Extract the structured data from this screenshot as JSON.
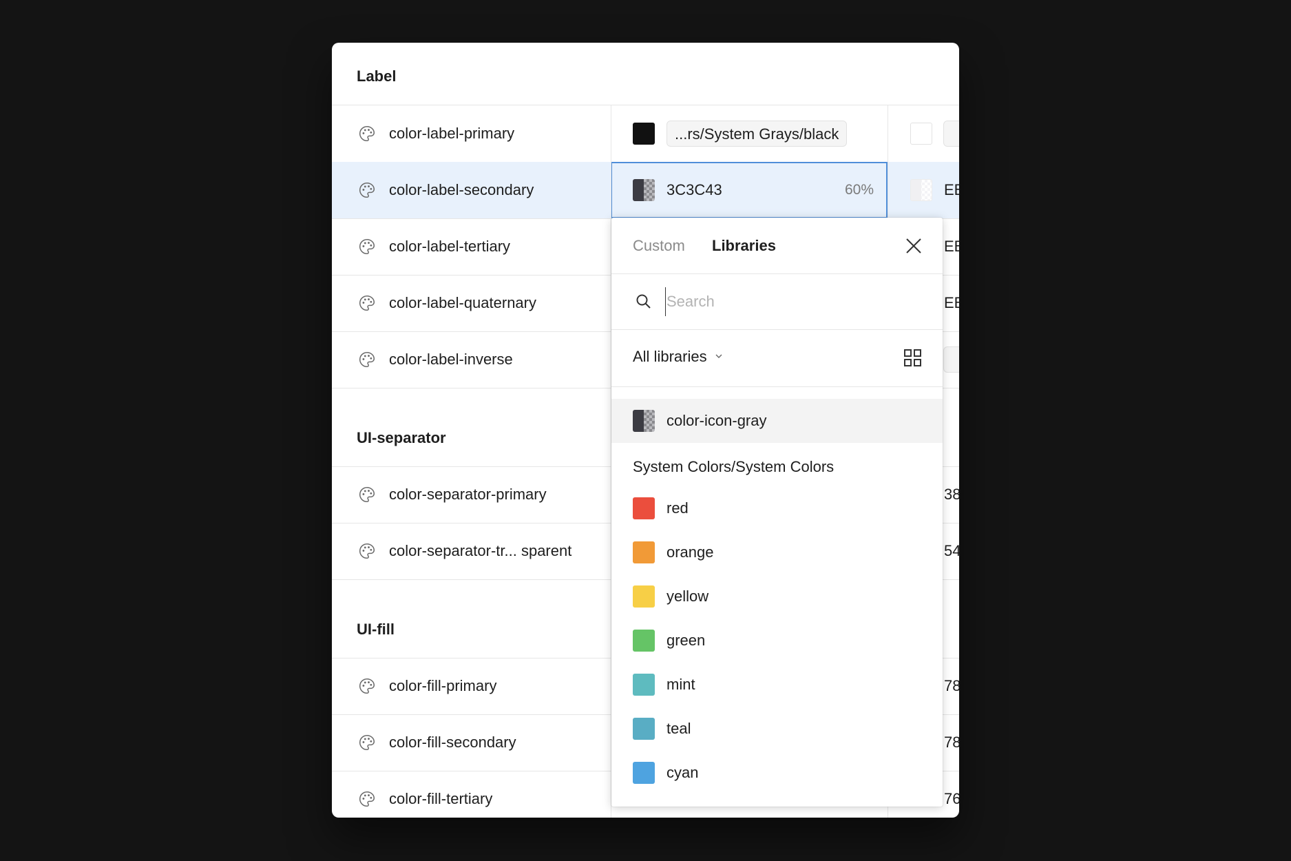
{
  "groups": [
    {
      "title": "Label"
    },
    {
      "title": "UI-separator"
    },
    {
      "title": "UI-fill"
    }
  ],
  "rows": {
    "label": [
      {
        "name": "color-label-primary"
      },
      {
        "name": "color-label-secondary"
      },
      {
        "name": "color-label-tertiary"
      },
      {
        "name": "color-label-quaternary"
      },
      {
        "name": "color-label-inverse"
      }
    ],
    "separator": [
      {
        "name": "color-separator-primary"
      },
      {
        "name": "color-separator-tr... sparent"
      }
    ],
    "fill": [
      {
        "name": "color-fill-primary"
      },
      {
        "name": "color-fill-secondary"
      },
      {
        "name": "color-fill-tertiary"
      }
    ]
  },
  "cells": {
    "primary_value": "...rs/System Grays/black",
    "secondary_value": "3C3C43",
    "secondary_opacity": "60%",
    "col3": {
      "secondary": "EB",
      "tertiary": "EB",
      "quaternary": "EB",
      "sep_primary": "38",
      "sep_transparent": "54",
      "fill_primary": "78",
      "fill_secondary": "78",
      "fill_tertiary": "76"
    }
  },
  "popover": {
    "tabs": [
      "Custom",
      "Libraries"
    ],
    "active_tab": "Libraries",
    "search": {
      "placeholder": "Search",
      "value": ""
    },
    "library_filter": "All libraries",
    "top_item": "color-icon-gray",
    "section": "System Colors/System Colors",
    "colors": [
      {
        "name": "red",
        "hex": "#eb4e3d"
      },
      {
        "name": "orange",
        "hex": "#f19a37"
      },
      {
        "name": "yellow",
        "hex": "#f7cf46"
      },
      {
        "name": "green",
        "hex": "#65c466"
      },
      {
        "name": "mint",
        "hex": "#5ebbbf"
      },
      {
        "name": "teal",
        "hex": "#59adc4"
      },
      {
        "name": "cyan",
        "hex": "#4ea3e0"
      }
    ]
  },
  "icons": {
    "row_icon": "palette-icon",
    "close": "close-icon",
    "search": "search-icon",
    "chevron": "chevron-down-icon",
    "grid": "grid-view-icon"
  }
}
